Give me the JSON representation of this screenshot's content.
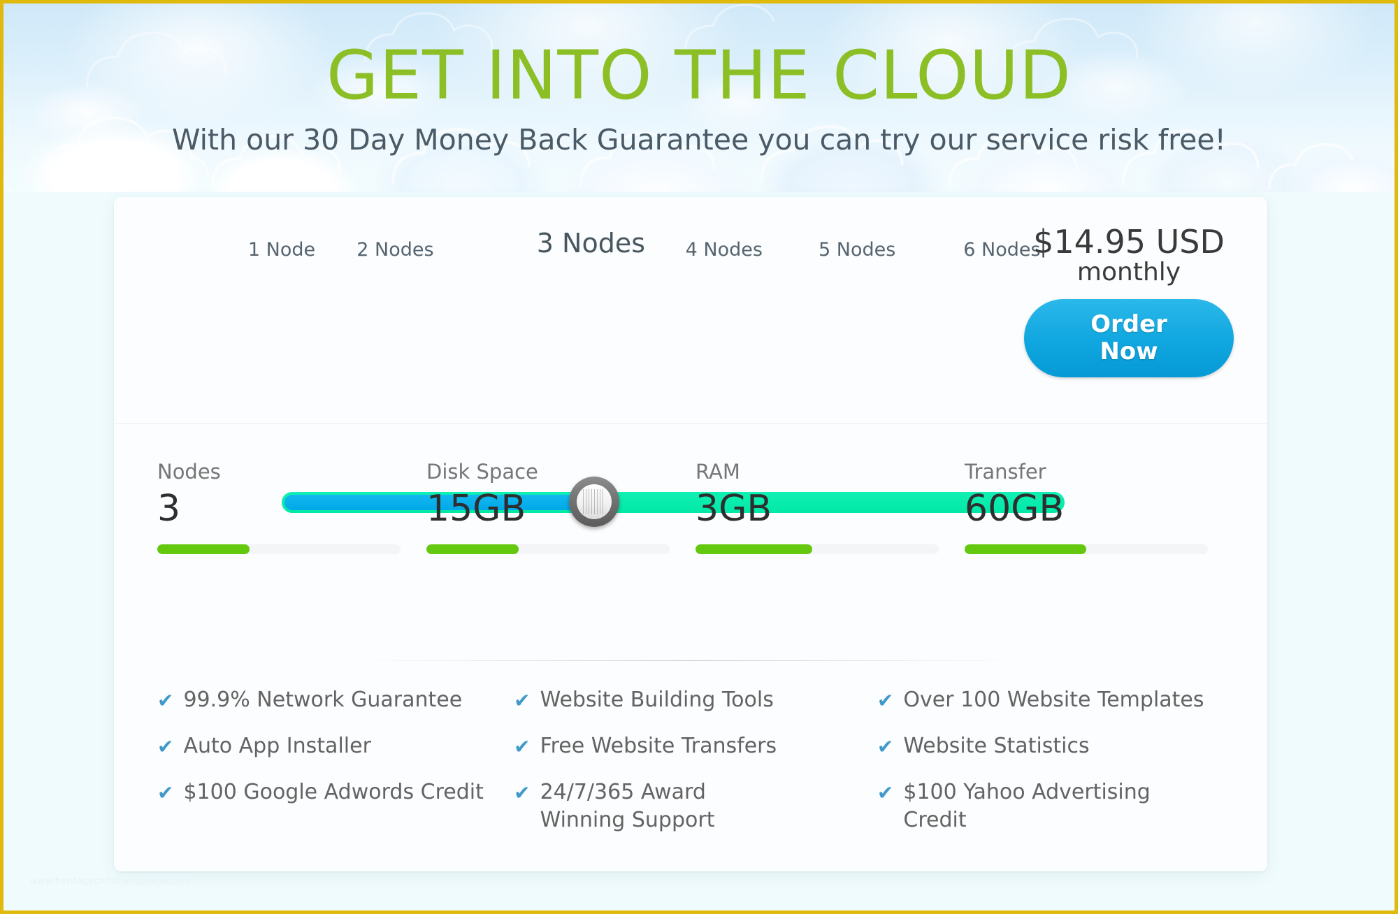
{
  "theme": {
    "page_border_color": "#e0b90d",
    "title_green": "#8cbf26",
    "slider_fill_blue": "#00a8e8",
    "slider_track_green": "#00e8a6",
    "bar_green": "#64c80f",
    "check_blue": "#3f9acb",
    "button_blue": "#11a7e0"
  },
  "hero": {
    "title": "GET INTO THE CLOUD",
    "subtitle": "With our 30 Day Money Back Guarantee you can try our service risk free!"
  },
  "slider": {
    "min": 1,
    "max": 6,
    "value": 3,
    "fill_percent": 39.5,
    "ticks": [
      {
        "label": "1 Node",
        "position_percent": 0
      },
      {
        "label": "2 Nodes",
        "position_percent": 14.5
      },
      {
        "label": "3 Nodes",
        "position_percent": 39.5
      },
      {
        "label": "4 Nodes",
        "position_percent": 56.5
      },
      {
        "label": "5 Nodes",
        "position_percent": 73.5
      },
      {
        "label": "6 Nodes",
        "position_percent": 92
      }
    ]
  },
  "price": {
    "amount": "$14.95 USD",
    "period": "monthly",
    "order_button_label": "Order\nNow",
    "order_button_line1": "Order",
    "order_button_line2": "Now"
  },
  "specs": [
    {
      "label": "Nodes",
      "value": "3",
      "bar_percent": 38
    },
    {
      "label": "Disk Space",
      "value": "15GB",
      "bar_percent": 38
    },
    {
      "label": "RAM",
      "value": "3GB",
      "bar_percent": 48
    },
    {
      "label": "Transfer",
      "value": "60GB",
      "bar_percent": 50
    }
  ],
  "features": {
    "check_glyph": "✔",
    "columns": [
      [
        "99.9% Network Guarantee",
        "Auto App Installer",
        "$100 Google Adwords Credit"
      ],
      [
        "Website Building Tools",
        "Free Website Transfers",
        "24/7/365 Award Winning Support"
      ],
      [
        "Over 100 Website Templates",
        "Website Statistics",
        "$100 Yahoo Advertising Credit"
      ]
    ]
  },
  "watermark": "www.heritagechristiancollege.com"
}
